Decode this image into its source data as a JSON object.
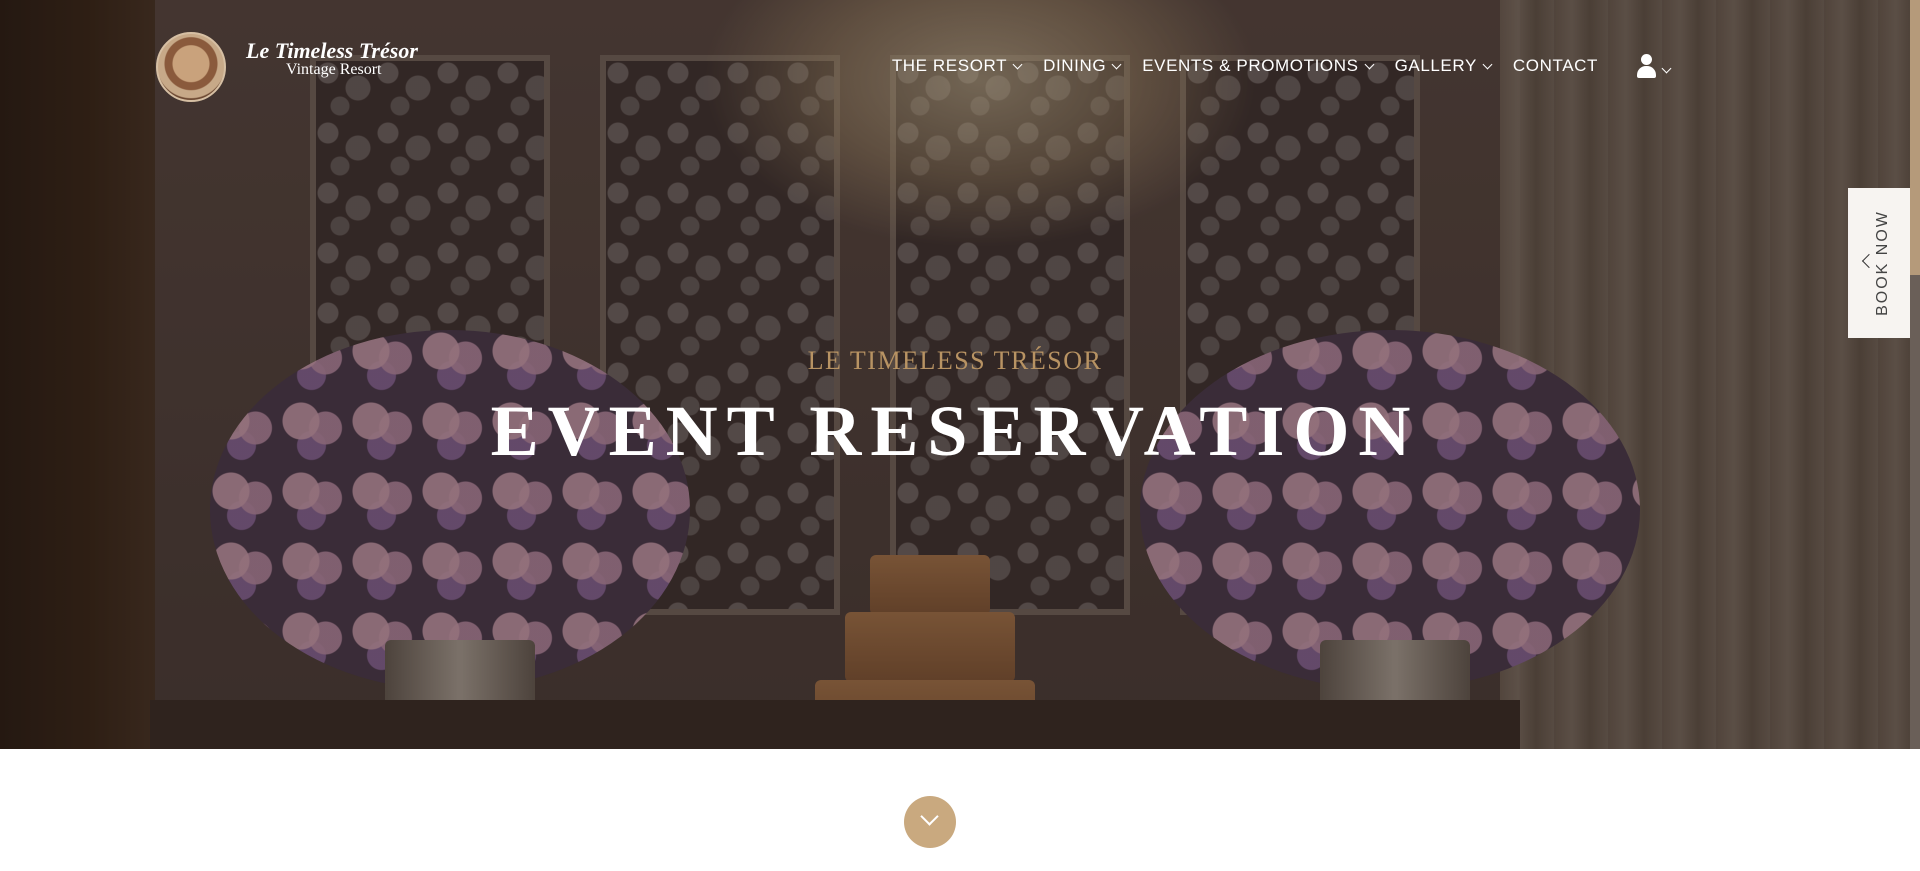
{
  "brand": {
    "name": "Le Timeless Trésor",
    "tagline": "Vintage Resort"
  },
  "nav": {
    "items": [
      {
        "label": "THE RESORT",
        "has_dropdown": true
      },
      {
        "label": "DINING",
        "has_dropdown": true
      },
      {
        "label": "EVENTS & PROMOTIONS",
        "has_dropdown": true
      },
      {
        "label": "GALLERY",
        "has_dropdown": true
      },
      {
        "label": "CONTACT",
        "has_dropdown": false
      }
    ],
    "user_icon": "user-icon"
  },
  "hero": {
    "kicker": "LE TIMELESS TRÉSOR",
    "title": "EVENT RESERVATION"
  },
  "book_now": {
    "label": "BOOK NOW"
  },
  "colors": {
    "accent_gold": "#b89363",
    "scroll_button": "#c9a97f",
    "book_now_bg": "#f7f4f1"
  }
}
